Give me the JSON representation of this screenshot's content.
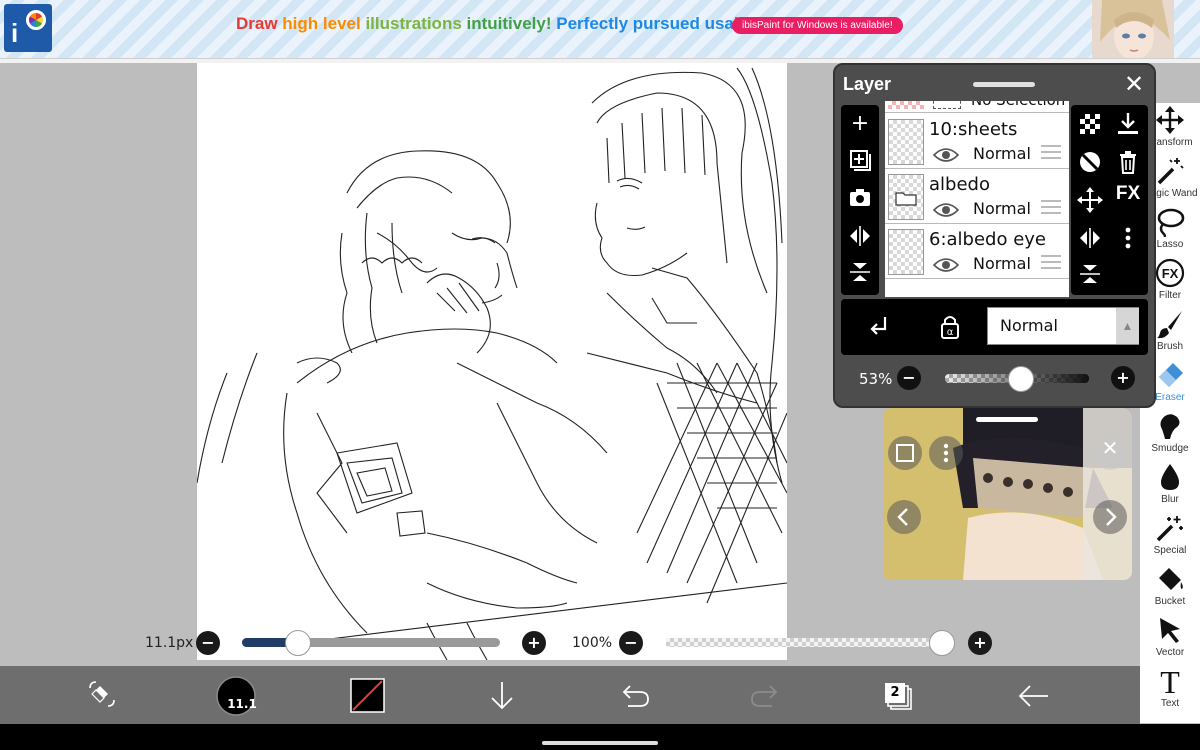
{
  "ad": {
    "segments": [
      "Draw ",
      "high level ",
      "illustrations ",
      "intuitively! ",
      "Perfectly pursued usability!"
    ],
    "pill": "ibisPaint for Windows is available!",
    "logo_icon": "ibispaint-logo"
  },
  "layer_panel": {
    "title": "Layer",
    "selection_label": "No Selection",
    "layers": [
      {
        "name": "10:sheets",
        "mode": "Normal",
        "type": "layer"
      },
      {
        "name": "albedo",
        "mode": "Normal",
        "type": "folder"
      },
      {
        "name": "6:albedo eye",
        "mode": "Normal",
        "type": "layer"
      }
    ],
    "blend_mode": "Normal",
    "opacity_label": "53%",
    "opacity": 0.53,
    "fx_label": "FX"
  },
  "tools": [
    {
      "label": "Transform",
      "icon": "transform-icon"
    },
    {
      "label": "Magic Wand",
      "icon": "magic-wand-icon"
    },
    {
      "label": "Lasso",
      "icon": "lasso-icon"
    },
    {
      "label": "Filter",
      "icon": "filter-icon"
    },
    {
      "label": "Brush",
      "icon": "brush-icon"
    },
    {
      "label": "Eraser",
      "icon": "eraser-icon",
      "active": true
    },
    {
      "label": "Smudge",
      "icon": "smudge-icon"
    },
    {
      "label": "Blur",
      "icon": "blur-icon"
    },
    {
      "label": "Special",
      "icon": "special-icon"
    },
    {
      "label": "Bucket",
      "icon": "bucket-icon"
    },
    {
      "label": "Vector",
      "icon": "vector-icon"
    },
    {
      "label": "Text",
      "icon": "text-icon"
    }
  ],
  "brush": {
    "size_label": "11.1px",
    "size_fraction": 0.17,
    "badge": "11.1"
  },
  "canvas_opacity": {
    "label": "100%",
    "value": 1.0
  },
  "bottom": {
    "layer_count": "2"
  },
  "colors": {
    "accent": "#3f8fd8",
    "panel": "#4d4d4d",
    "bottom_bar": "#6e6e6e",
    "brush_fill": "#1f3d66"
  }
}
